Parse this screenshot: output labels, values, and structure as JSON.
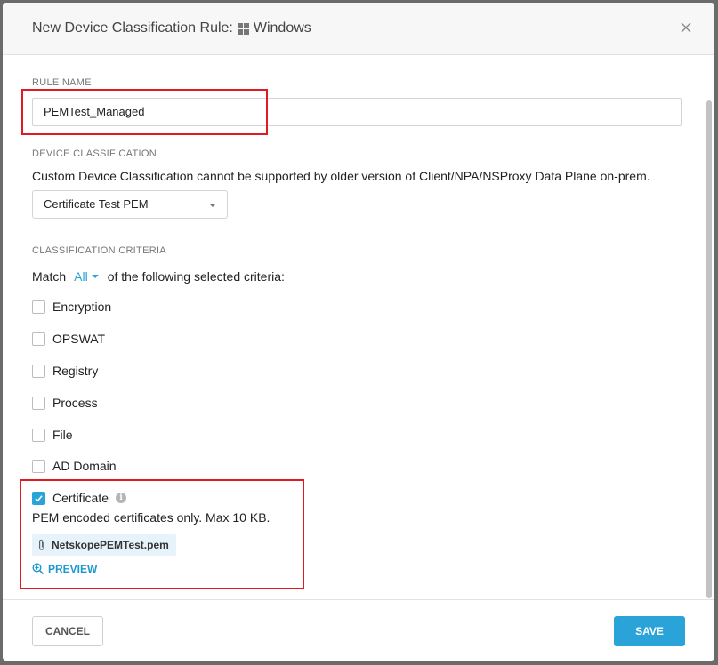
{
  "dialog": {
    "title": "New Device Classification Rule:",
    "os_label": "Windows"
  },
  "rule_name": {
    "label": "RULE NAME",
    "value": "PEMTest_Managed"
  },
  "device_classification": {
    "label": "DEVICE CLASSIFICATION",
    "description": "Custom Device Classification cannot be supported by older version of Client/NPA/NSProxy Data Plane on-prem.",
    "selected": "Certificate Test PEM"
  },
  "criteria": {
    "label": "CLASSIFICATION CRITERIA",
    "match_prefix": "Match",
    "match_value": "All",
    "match_suffix": "of the following selected criteria:",
    "items": [
      {
        "label": "Encryption",
        "checked": false
      },
      {
        "label": "OPSWAT",
        "checked": false
      },
      {
        "label": "Registry",
        "checked": false
      },
      {
        "label": "Process",
        "checked": false
      },
      {
        "label": "File",
        "checked": false
      },
      {
        "label": "AD Domain",
        "checked": false
      },
      {
        "label": "Certificate",
        "checked": true
      }
    ],
    "certificate_note": "PEM encoded certificates only. Max 10 KB.",
    "file_name": "NetskopePEMTest.pem",
    "preview_label": "PREVIEW"
  },
  "footer": {
    "cancel_label": "CANCEL",
    "save_label": "SAVE"
  },
  "colors": {
    "accent": "#2aa3d9",
    "highlight": "#e11b22"
  }
}
